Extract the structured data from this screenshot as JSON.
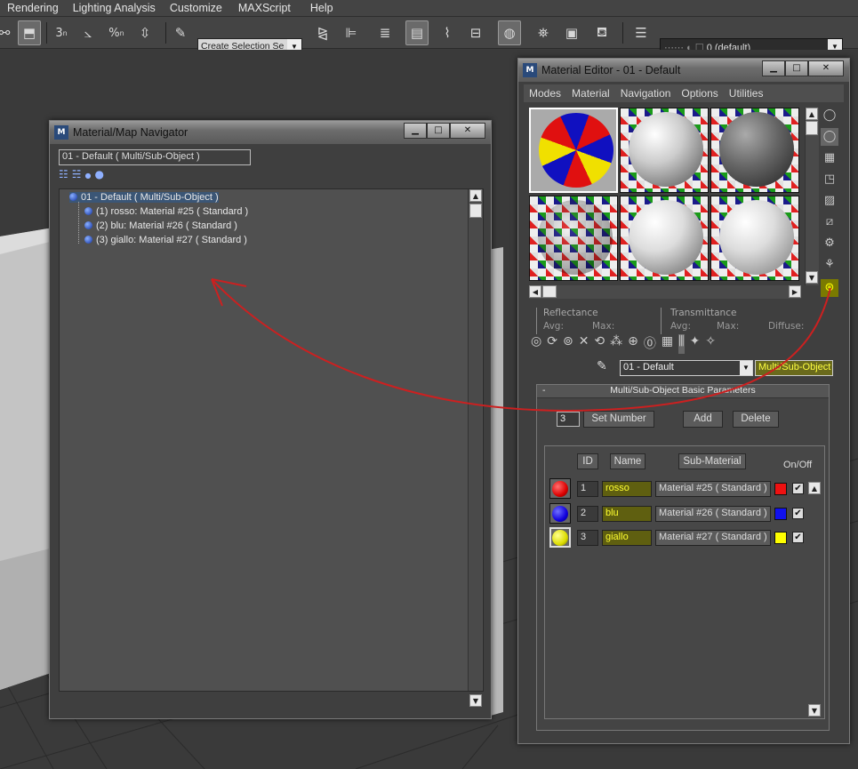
{
  "menubar": {
    "items": [
      "Rendering",
      "Lighting Analysis",
      "Customize",
      "MAXScript",
      "Help"
    ]
  },
  "toolbar": {
    "selection_set": "Create Selection Se",
    "layer": "0 (default)",
    "snap_labels": [
      "3",
      "%",
      "3"
    ]
  },
  "navigator": {
    "title": "Material/Map Navigator",
    "current": "01 - Default  ( Multi/Sub-Object )",
    "tree": [
      "01 - Default  ( Multi/Sub-Object )",
      "(1) rosso: Material #25  ( Standard )",
      "(2) blu: Material #26  ( Standard )",
      "(3) giallo: Material #27  ( Standard )"
    ]
  },
  "editor": {
    "title": "Material Editor - 01 - Default",
    "menu": [
      "Modes",
      "Material",
      "Navigation",
      "Options",
      "Utilities"
    ],
    "reflectance": "Reflectance",
    "transmittance": "Transmittance",
    "avg": "Avg:",
    "max": "Max:",
    "diffuse": "Diffuse:",
    "material_name": "01 - Default",
    "material_type": "Multi/Sub-Object",
    "rollout_title": "Multi/Sub-Object Basic Parameters",
    "rollout_toggle": "-",
    "count": "3",
    "set_number": "Set Number",
    "add": "Add",
    "delete": "Delete",
    "col_id": "ID",
    "col_name": "Name",
    "col_sub": "Sub-Material",
    "col_onoff": "On/Off",
    "rows": [
      {
        "id": "1",
        "name": "rosso",
        "sub": "Material #25  ( Standard )",
        "color": "#ee1111",
        "ball": "#dd1111"
      },
      {
        "id": "2",
        "name": "blu",
        "sub": "Material #26  ( Standard )",
        "color": "#1111ee",
        "ball": "#1111dd"
      },
      {
        "id": "3",
        "name": "giallo",
        "sub": "Material #27  ( Standard )",
        "color": "#ffff00",
        "ball": "#e8e800"
      }
    ],
    "check": "✔"
  },
  "icons": {
    "close": "✕",
    "min": "▁",
    "max": "□",
    "dd": "▼",
    "up": "▲",
    "left": "◀",
    "right": "▶"
  }
}
